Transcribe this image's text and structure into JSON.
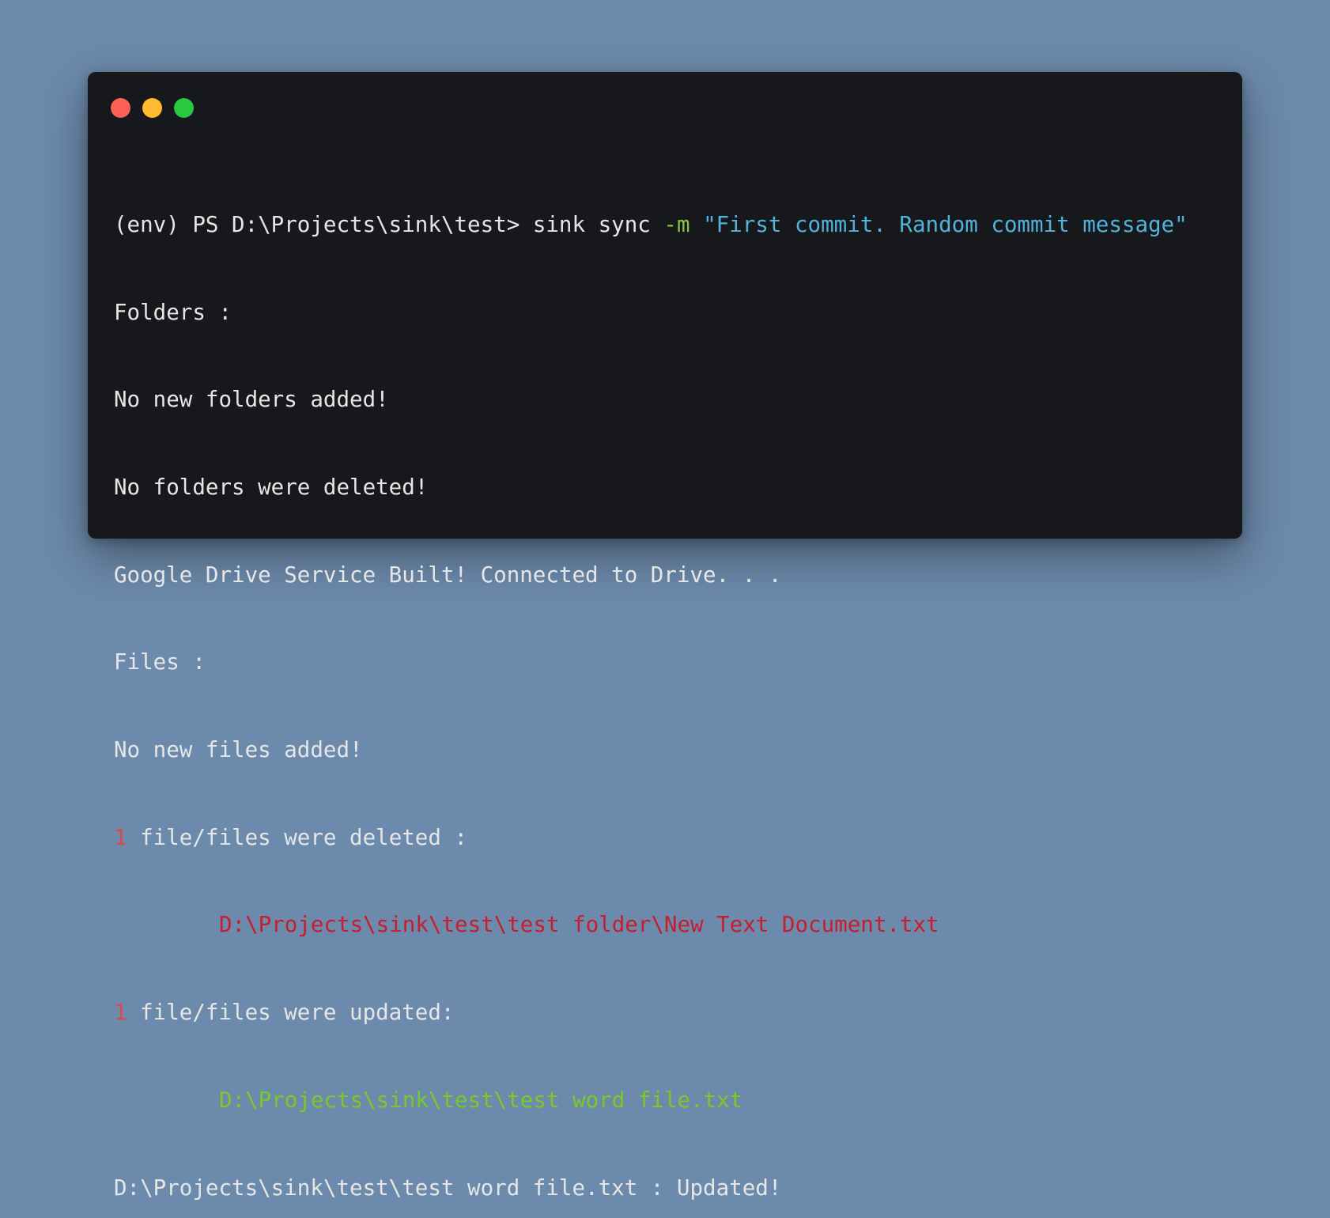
{
  "colors": {
    "background": "#6c8aab",
    "window": "#17181b",
    "text": "#e6e6e6",
    "flag": "#8cc63f",
    "string": "#4fb3da",
    "number": "#e0464e",
    "deleted_path": "#c81d2d",
    "updated_path": "#79c92a",
    "close_button": "#fe5f57",
    "minimize_button": "#febc2e",
    "maximize_button": "#28c840"
  },
  "window_controls": [
    "close-icon",
    "minimize-icon",
    "maximize-icon"
  ],
  "terminal": {
    "prompt": "(env) PS D:\\Projects\\sink\\test> ",
    "command": "sink sync ",
    "flag": "-m",
    "message": "\"First commit. Random commit message\"",
    "folders_header": "Folders :",
    "no_new_folders": "No new folders added!",
    "no_folders_deleted": "No folders were deleted!",
    "drive_status": "Google Drive Service Built! Connected to Drive. . .",
    "files_header": "Files :",
    "no_new_files": "No new files added!",
    "deleted_count": "1",
    "deleted_text": " file/files were deleted :",
    "deleted_path": "D:\\Projects\\sink\\test\\test folder\\New Text Document.txt",
    "updated_count": "1",
    "updated_text": " file/files were updated:",
    "updated_path": "D:\\Projects\\sink\\test\\test word file.txt",
    "final_status": "D:\\Projects\\sink\\test\\test word file.txt : Updated!"
  }
}
